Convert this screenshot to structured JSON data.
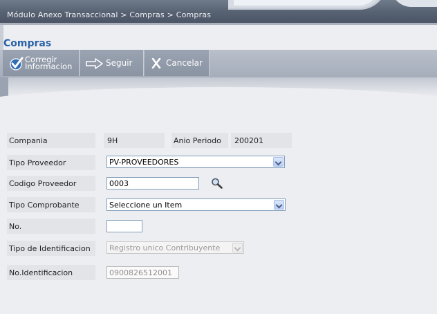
{
  "header": {
    "breadcrumb": "Módulo Anexo Transaccional > Compras > Compras"
  },
  "page": {
    "title": "Compras"
  },
  "toolbar": {
    "corregir_label": "Corregir Informacion",
    "seguir_label": "Seguir",
    "cancelar_label": "Cancelar"
  },
  "form": {
    "compania_label": "Compania",
    "compania_value": "9H",
    "anio_periodo_label": "Anio Periodo",
    "anio_periodo_value": "200201",
    "tipo_proveedor_label": "Tipo Proveedor",
    "tipo_proveedor_selected": "PV-PROVEEDORES",
    "codigo_proveedor_label": "Codigo Proveedor",
    "codigo_proveedor_value": "0003",
    "tipo_comprobante_label": "Tipo Comprobante",
    "tipo_comprobante_selected": "Seleccione un Item",
    "no_label": "No.",
    "no_value": "",
    "tipo_identificacion_label": "Tipo de Identificacion",
    "tipo_identificacion_selected": "Registro unico Contribuyente",
    "no_identificacion_label": "No.Identificacion",
    "no_identificacion_value": "0900826512001"
  },
  "icons": {
    "corregir": "check-icon",
    "seguir": "arrow-right-icon",
    "cancelar": "x-icon",
    "lookup": "magnifier-icon"
  },
  "colors": {
    "title": "#2a62a8",
    "toolbar": "#9aa3b1",
    "banner": "#566172"
  }
}
